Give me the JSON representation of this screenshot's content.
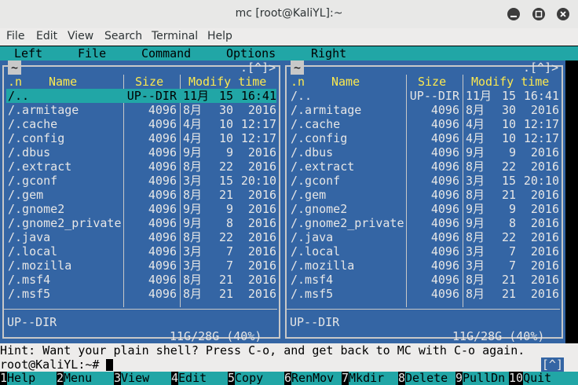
{
  "window": {
    "title": "mc [root@KaliYL]:~",
    "minimize_icon": "minimize-icon",
    "maximize_icon": "maximize-icon",
    "close_icon": "close-icon"
  },
  "menubar": [
    "File",
    "Edit",
    "View",
    "Search",
    "Terminal",
    "Help"
  ],
  "mc_menu": [
    "Left",
    "File",
    "Command",
    "Options",
    "Right"
  ],
  "left_panel": {
    "path": "~",
    "hist": ".[^]>",
    "cols": {
      "n": ".n",
      "name": "Name",
      "size": "Size",
      "modify": "Modify time"
    },
    "rows": [
      {
        "name": "/..",
        "size": "UP--DIR",
        "mon": "11月",
        "day": "15",
        "time": "16:41"
      },
      {
        "name": "/.armitage",
        "size": "4096",
        "mon": "8月",
        "day": "30",
        "time": "2016"
      },
      {
        "name": "/.cache",
        "size": "4096",
        "mon": "4月",
        "day": "10",
        "time": "12:17"
      },
      {
        "name": "/.config",
        "size": "4096",
        "mon": "4月",
        "day": "10",
        "time": "12:17"
      },
      {
        "name": "/.dbus",
        "size": "4096",
        "mon": "9月",
        "day": "9",
        "time": "2016"
      },
      {
        "name": "/.extract",
        "size": "4096",
        "mon": "8月",
        "day": "22",
        "time": "2016"
      },
      {
        "name": "/.gconf",
        "size": "4096",
        "mon": "3月",
        "day": "15",
        "time": "20:10"
      },
      {
        "name": "/.gem",
        "size": "4096",
        "mon": "8月",
        "day": "21",
        "time": "2016"
      },
      {
        "name": "/.gnome2",
        "size": "4096",
        "mon": "9月",
        "day": "9",
        "time": "2016"
      },
      {
        "name": "/.gnome2_private",
        "size": "4096",
        "mon": "9月",
        "day": "8",
        "time": "2016"
      },
      {
        "name": "/.java",
        "size": "4096",
        "mon": "8月",
        "day": "22",
        "time": "2016"
      },
      {
        "name": "/.local",
        "size": "4096",
        "mon": "3月",
        "day": "7",
        "time": "2016"
      },
      {
        "name": "/.mozilla",
        "size": "4096",
        "mon": "3月",
        "day": "7",
        "time": "2016"
      },
      {
        "name": "/.msf4",
        "size": "4096",
        "mon": "8月",
        "day": "21",
        "time": "2016"
      },
      {
        "name": "/.msf5",
        "size": "4096",
        "mon": "8月",
        "day": "21",
        "time": "2016"
      }
    ],
    "status": "UP--DIR",
    "disk": "11G/28G (40%)"
  },
  "right_panel": {
    "path": "~",
    "hist": ".[^]>",
    "cols": {
      "n": ".n",
      "name": "Name",
      "size": "Size",
      "modify": "Modify time"
    },
    "rows": [
      {
        "name": "/..",
        "size": "UP--DIR",
        "mon": "11月",
        "day": "15",
        "time": "16:41"
      },
      {
        "name": "/.armitage",
        "size": "4096",
        "mon": "8月",
        "day": "30",
        "time": "2016"
      },
      {
        "name": "/.cache",
        "size": "4096",
        "mon": "4月",
        "day": "10",
        "time": "12:17"
      },
      {
        "name": "/.config",
        "size": "4096",
        "mon": "4月",
        "day": "10",
        "time": "12:17"
      },
      {
        "name": "/.dbus",
        "size": "4096",
        "mon": "9月",
        "day": "9",
        "time": "2016"
      },
      {
        "name": "/.extract",
        "size": "4096",
        "mon": "8月",
        "day": "22",
        "time": "2016"
      },
      {
        "name": "/.gconf",
        "size": "4096",
        "mon": "3月",
        "day": "15",
        "time": "20:10"
      },
      {
        "name": "/.gem",
        "size": "4096",
        "mon": "8月",
        "day": "21",
        "time": "2016"
      },
      {
        "name": "/.gnome2",
        "size": "4096",
        "mon": "9月",
        "day": "9",
        "time": "2016"
      },
      {
        "name": "/.gnome2_private",
        "size": "4096",
        "mon": "9月",
        "day": "8",
        "time": "2016"
      },
      {
        "name": "/.java",
        "size": "4096",
        "mon": "8月",
        "day": "22",
        "time": "2016"
      },
      {
        "name": "/.local",
        "size": "4096",
        "mon": "3月",
        "day": "7",
        "time": "2016"
      },
      {
        "name": "/.mozilla",
        "size": "4096",
        "mon": "3月",
        "day": "7",
        "time": "2016"
      },
      {
        "name": "/.msf4",
        "size": "4096",
        "mon": "8月",
        "day": "21",
        "time": "2016"
      },
      {
        "name": "/.msf5",
        "size": "4096",
        "mon": "8月",
        "day": "21",
        "time": "2016"
      }
    ],
    "status": "UP--DIR",
    "disk": "11G/28G (40%)"
  },
  "hint": "Hint: Want your plain shell? Press C-o, and get back to MC with C-o again.",
  "prompt": "root@KaliYL:~#",
  "prompt_hist": "[^]",
  "fkeys": [
    {
      "num": "1",
      "label": "Help"
    },
    {
      "num": "2",
      "label": "Menu"
    },
    {
      "num": "3",
      "label": "View"
    },
    {
      "num": "4",
      "label": "Edit"
    },
    {
      "num": "5",
      "label": "Copy"
    },
    {
      "num": "6",
      "label": "RenMov"
    },
    {
      "num": "7",
      "label": "Mkdir"
    },
    {
      "num": "8",
      "label": "Delete"
    },
    {
      "num": "9",
      "label": "PullDn"
    },
    {
      "num": "10",
      "label": "Quit"
    }
  ],
  "colors": {
    "panel": "#3465a4",
    "accent": "#21a6a6",
    "header": "#fce94f"
  }
}
